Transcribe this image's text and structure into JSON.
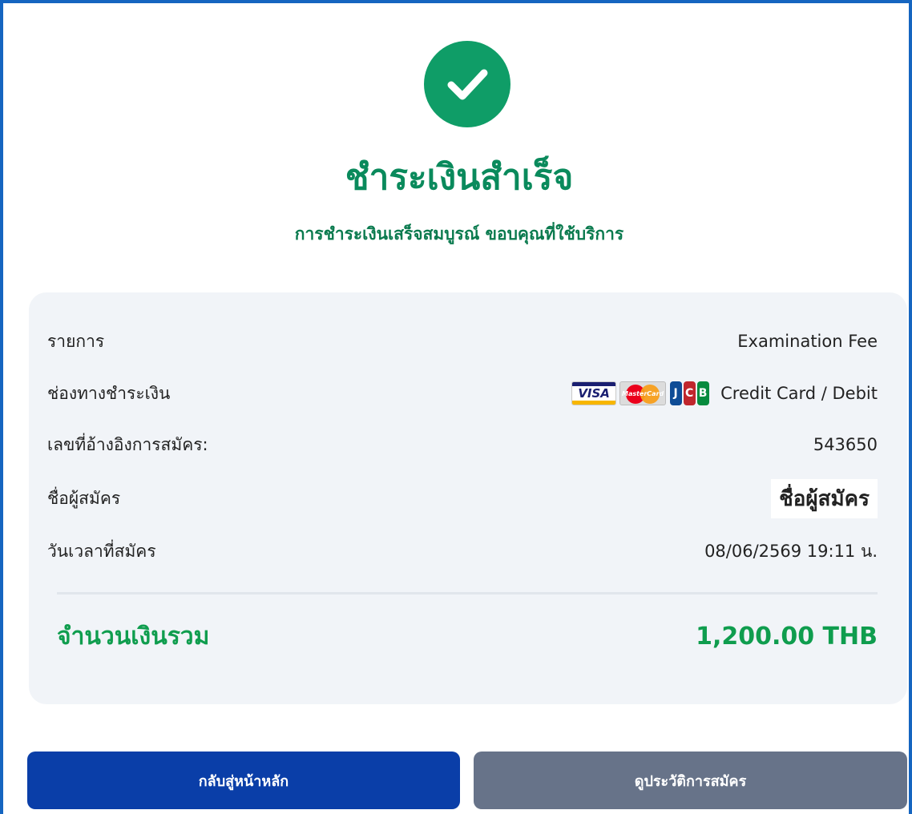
{
  "header": {
    "icon": "check-circle-icon",
    "title": "ชำระเงินสำเร็จ",
    "subtitle": "การชำระเงินเสร็จสมบูรณ์ ขอบคุณที่ใช้บริการ"
  },
  "details": {
    "item_label": "รายการ",
    "item_value": "Examination Fee",
    "method_label": "ช่องทางชำระเงิน",
    "method_value": "Credit Card / Debit",
    "method_logos": {
      "visa": "VISA",
      "mastercard": "MasterCard",
      "jcb": [
        "J",
        "C",
        "B"
      ]
    },
    "ref_label": "เลขที่อ้างอิงการสมัคร:",
    "ref_value": "543650",
    "name_label": "ชื่อผู้สมัคร",
    "name_value": "ชื่อผู้สมัคร",
    "datetime_label": "วันเวลาที่สมัคร",
    "datetime_value": "08/06/2569 19:11 น."
  },
  "total": {
    "label": "จำนวนเงินรวม",
    "value": "1,200.00 THB"
  },
  "buttons": {
    "home": "กลับสู่หน้าหลัก",
    "history": "ดูประวัติการสมัคร"
  },
  "colors": {
    "success": "#0f9d67",
    "primary_button": "#0a3ea8",
    "secondary_button": "#677389",
    "total_text": "#0f9d4e",
    "frame_border": "#1565c0"
  }
}
